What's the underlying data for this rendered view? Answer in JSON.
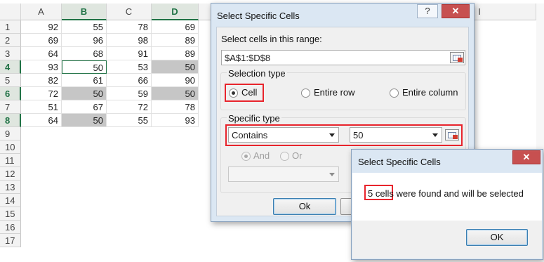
{
  "sheet": {
    "columns": [
      "A",
      "B",
      "C",
      "D",
      "",
      "",
      "",
      "",
      "",
      "I"
    ],
    "rows": [
      "1",
      "2",
      "3",
      "4",
      "5",
      "6",
      "7",
      "8",
      "9",
      "10",
      "11",
      "12",
      "13",
      "14",
      "15",
      "16",
      "17"
    ],
    "data": [
      [
        "92",
        "55",
        "78",
        "69"
      ],
      [
        "69",
        "96",
        "98",
        "89"
      ],
      [
        "64",
        "68",
        "91",
        "89"
      ],
      [
        "93",
        "50",
        "53",
        "50"
      ],
      [
        "82",
        "61",
        "66",
        "90"
      ],
      [
        "72",
        "50",
        "59",
        "50"
      ],
      [
        "51",
        "67",
        "72",
        "78"
      ],
      [
        "64",
        "50",
        "55",
        "93"
      ]
    ]
  },
  "dialog": {
    "title": "Select Specific Cells",
    "help_icon": "help-icon",
    "close_icon": "close-icon",
    "help_glyph": "?",
    "close_glyph": "✕",
    "range_label": "Select cells in this range:",
    "range_value": "$A$1:$D$8",
    "selection_type_label": "Selection type",
    "option_cell": "Cell",
    "option_entire_row": "Entire row",
    "option_entire_column": "Entire column",
    "specific_type_label": "Specific type",
    "condition1": "Contains",
    "value1": "50",
    "and_label": "And",
    "or_label": "Or",
    "ok_label": "Ok"
  },
  "message": {
    "title": "Select Specific Cells",
    "close_glyph": "✕",
    "count_text": "5 cells",
    "rest_text": " were found and will be selected",
    "ok_label": "OK"
  },
  "colors": {
    "accent_green": "#217346",
    "highlight_red": "#e8242c",
    "selection_gray": "#c6c6c6"
  }
}
